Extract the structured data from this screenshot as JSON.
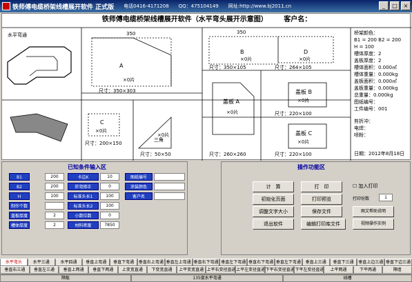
{
  "titlebar": {
    "title": "铁师傅电缆桥架线槽展开软件  正式版",
    "phone": "电话0416-4171208",
    "qq": "QQ：475104149",
    "url": "网址:http://www.bj2011.cn"
  },
  "canvas": {
    "header": "铁师傅电缆桥架线槽展开软件（水平弯头展开示意图）",
    "customer_label": "客户名：",
    "diagram_label": "水平弯通",
    "box_a": {
      "dim_top": "350",
      "dim_right1": "100",
      "dim_right2": "303",
      "dim_right3": "200",
      "label": "A",
      "qty": "×0片",
      "size": "尺寸：350×303"
    },
    "box_b": {
      "dims": [
        "100",
        "71",
        "100",
        "105",
        "98",
        "8"
      ],
      "label": "B",
      "qty": "×0片",
      "size": "尺寸：350×105",
      "dim_top": "350"
    },
    "box_d": {
      "dims": [
        "100",
        "71",
        "100",
        "105",
        "264"
      ],
      "label": "D",
      "qty": "×0片",
      "size": "尺寸：264×105"
    },
    "box_c": {
      "dim_top": "200",
      "dim_right": "150",
      "label": "C",
      "qty": "×0片",
      "size": "尺寸：200×150"
    },
    "box_tri": {
      "dims": [
        "71",
        "50",
        "50"
      ],
      "label": "三角",
      "qty": "×0片",
      "size": "尺寸：50×50"
    },
    "box_cover_a": {
      "dim_top": "260",
      "dim_left": "250",
      "dims": [
        "36",
        "200",
        "36"
      ],
      "label": "盖板 A",
      "qty": "×0片",
      "size": "尺寸：260×260"
    },
    "box_cover_b": {
      "dim_left": "100",
      "dim_bottom": "220",
      "dim_small": "29",
      "label": "盖板 B",
      "qty": "×0片",
      "size": "尺寸：220×100"
    },
    "box_cover_c": {
      "dim_top": "220",
      "dim_left": "100",
      "label": "盖板 C",
      "qty": "×0片",
      "size": "尺寸：220×100"
    },
    "info": {
      "color": "桥架颜色：",
      "b1b2": "B1 = 200  B2 = 200",
      "h": "H = 100",
      "trough_thk": "槽体厚度：2",
      "cover_thk": "盖板厚度：2",
      "trough_area": "槽体面积：0.000㎡",
      "trough_weight": "槽体重量：0.000kg",
      "cover_area": "盖板面积：0.000㎡",
      "cover_weight": "盖板重量：0.000kg",
      "total_weight": "总重量：0.000kg",
      "drawing_no": "图纸编号：",
      "order_no": "工件编号：001",
      "cutting": "剪折冲：",
      "welding": "电焊：",
      "painting": "喷粉：",
      "date": "日期：2012年8月18日"
    }
  },
  "known": {
    "title": "已知条件输入区",
    "rows": [
      {
        "l1": "B1",
        "v1": "200",
        "l2": "卡边K",
        "v2": "10",
        "l3": "图纸编号",
        "v3": ""
      },
      {
        "l1": "B2",
        "v1": "200",
        "l2": "折弯修正",
        "v2": "0",
        "l3": "涂装颜色",
        "v3": ""
      },
      {
        "l1": "H",
        "v1": "100",
        "l2": "标准头长1",
        "v2": "100",
        "l3": "客户名",
        "v3": ""
      },
      {
        "l1": "制作个数",
        "v1": "",
        "l2": "标准头长2",
        "v2": "100",
        "l3": "",
        "v3": ""
      },
      {
        "l1": "盖板厚度",
        "v1": "2",
        "l2": "小数位数",
        "v2": "0",
        "l3": "",
        "v3": ""
      },
      {
        "l1": "槽体厚度",
        "v1": "2",
        "l2": "材料密度",
        "v2": "7850",
        "l3": "",
        "v3": ""
      }
    ]
  },
  "ops": {
    "title": "操作功能区",
    "btn_calc": "计　算",
    "btn_print": "打　印",
    "btn_init": "初始化页面",
    "btn_preview": "打印预览",
    "btn_font": "调整文字大小",
    "btn_save": "保存文件",
    "btn_exit": "退出软件",
    "btn_edit": "编辑打印库文件",
    "chk_add": "加入打印",
    "copies_label": "打印份数",
    "copies": "1",
    "btn_help": "图文帮助说明",
    "btn_video": "视频操作实例"
  },
  "tabs_row1": [
    "水平弯头",
    "水平三通",
    "水平四通",
    "垂直上弯通",
    "垂直下弯通",
    "垂直右上弯通",
    "垂直左上弯通",
    "垂直右下弯通",
    "垂直左下弯通",
    "垂直右下弯通",
    "垂直左下弯通",
    "垂直上三通",
    "垂直下三通",
    "垂直上边三通",
    "垂直下边三通"
  ],
  "tabs_row2": [
    "垂直右三通",
    "垂直左三通",
    "垂直上两通",
    "垂直下两通",
    "上变宽直通",
    "下变宽直通",
    "上平变宽直通",
    "上平右变径直通",
    "上平左变径直通",
    "下平右变径直通",
    "下平左变径直通",
    "上平两通",
    "下平两通",
    "隔墙"
  ],
  "status": [
    "隔板",
    "135度水平弯通",
    "线槽"
  ]
}
